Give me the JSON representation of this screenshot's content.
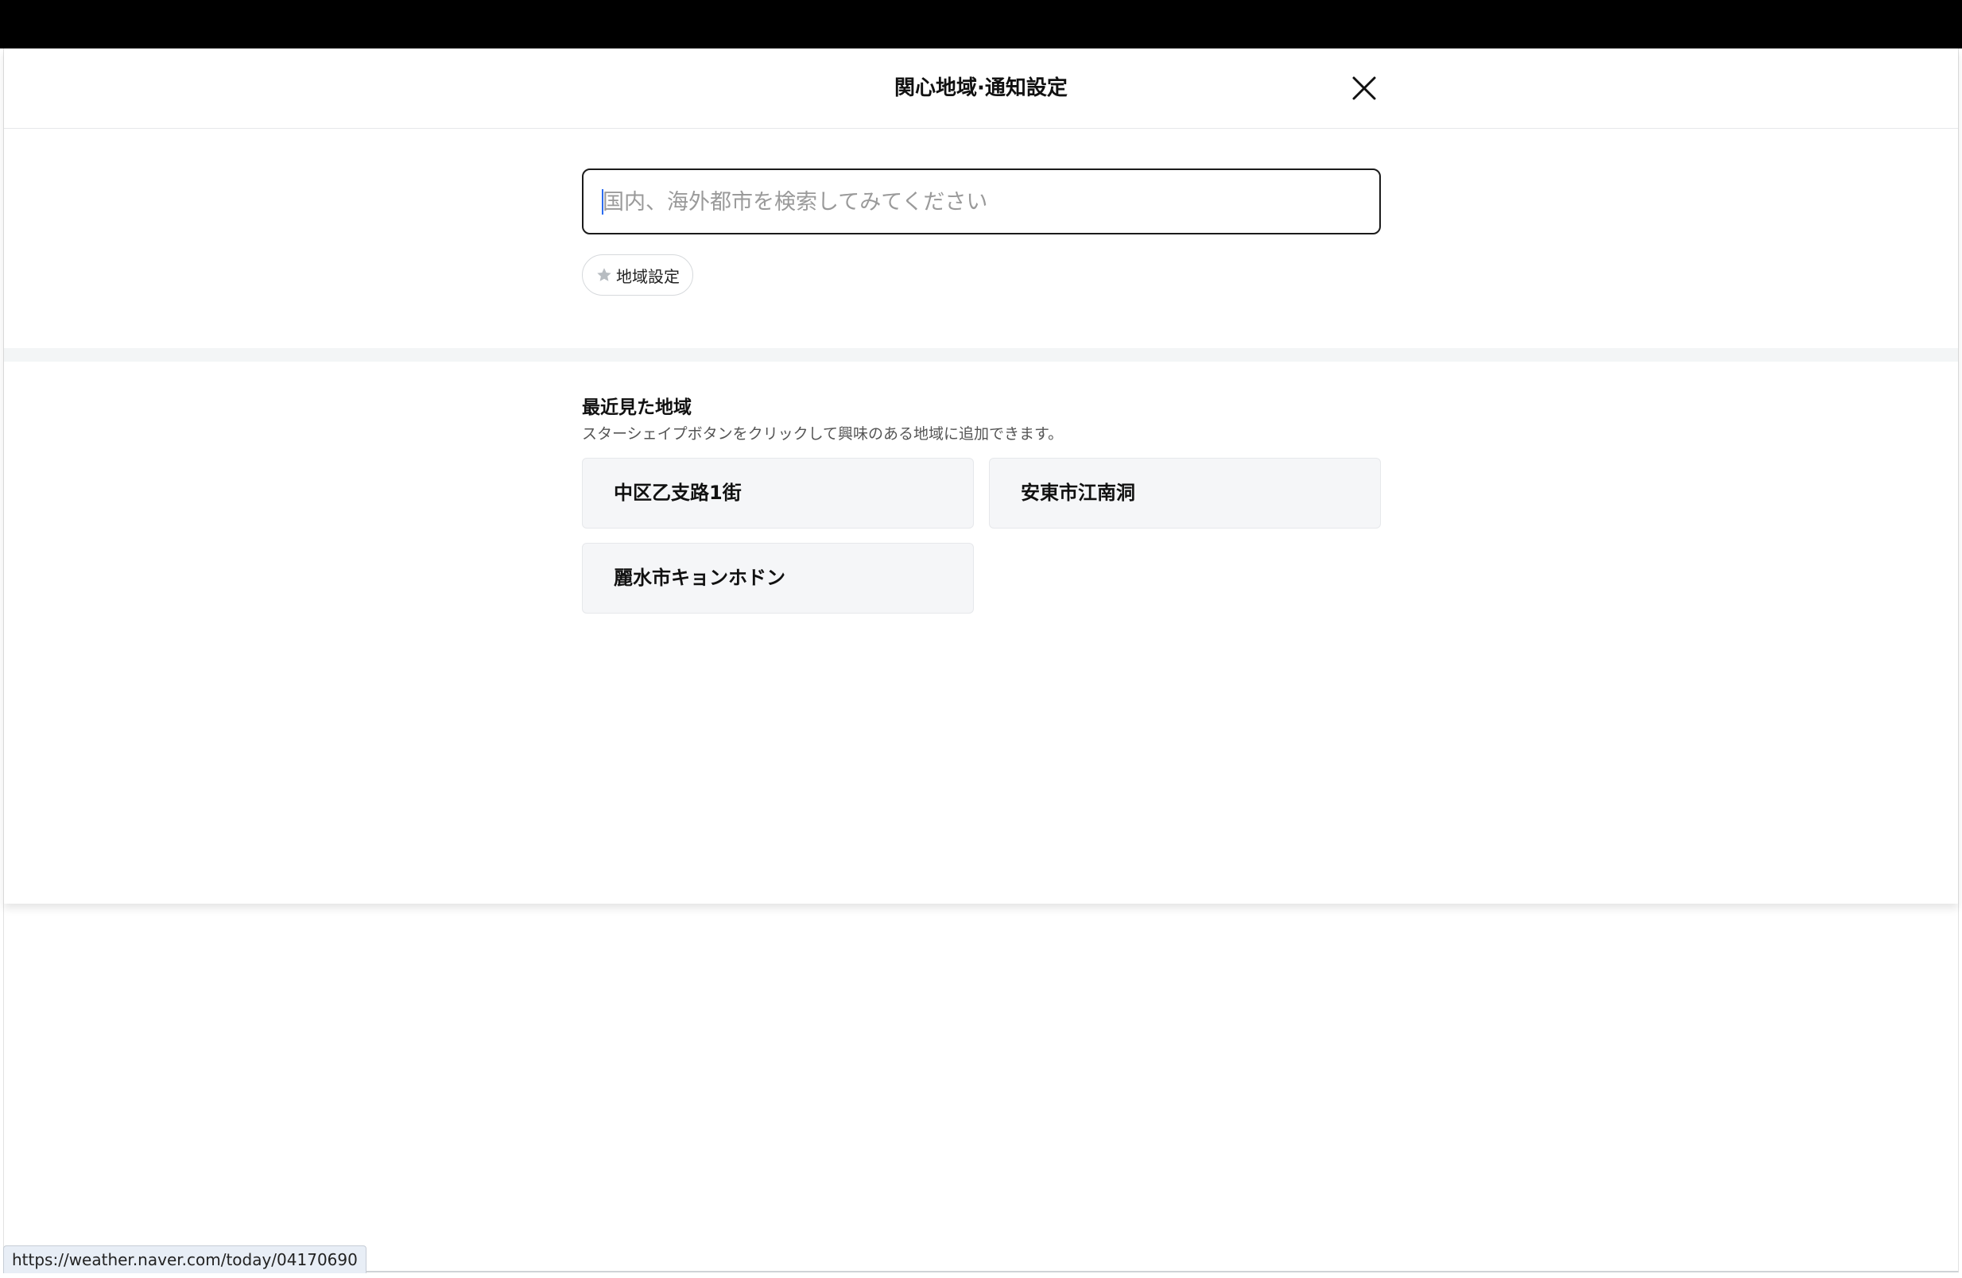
{
  "header": {
    "title": "関心地域·通知設定"
  },
  "search": {
    "placeholder": "国内、海外都市を検索してみてください",
    "value": ""
  },
  "region_setting": {
    "label": "地域設定",
    "icon": "star-icon"
  },
  "recent": {
    "title": "最近見た地域",
    "description": "スターシェイプボタンをクリックして興味のある地域に追加できます。",
    "items": [
      {
        "label": "中区乙支路1街"
      },
      {
        "label": "安東市江南洞"
      },
      {
        "label": "麗水市キョンホドン"
      }
    ]
  },
  "status_bar": {
    "url": "https://weather.naver.com/today/04170690"
  },
  "colors": {
    "divider": "#f3f5f6",
    "card_bg": "#f5f6f8",
    "caret": "#2b6cf0"
  }
}
